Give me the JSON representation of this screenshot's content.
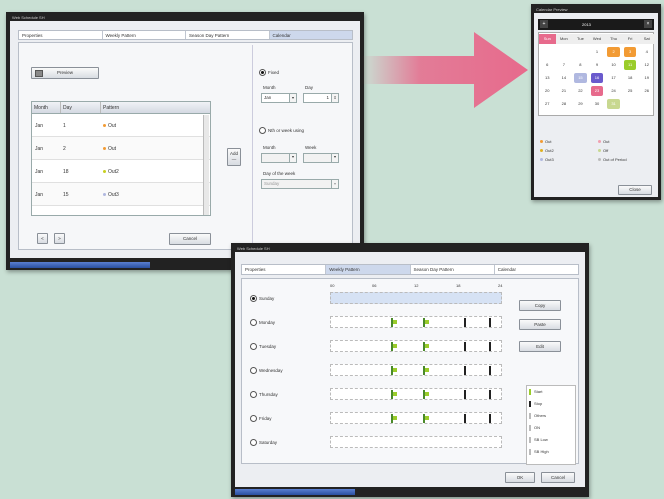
{
  "colors": {
    "accent": "#e76a8c",
    "header_blue": "#0d3a82",
    "green": "#9acc2a",
    "orange": "#f29b34",
    "selection": "#cdd8ec"
  },
  "w1": {
    "title": "Web Schedule SH",
    "tabs": [
      "Properties",
      "Weekly Pattern",
      "Season Day Pattern",
      "Calendar"
    ],
    "preview": "Preview",
    "cols": [
      "Month",
      "Day",
      "Pattern"
    ],
    "rows": [
      [
        "Jan",
        "1",
        "Out"
      ],
      [
        "Jan",
        "2",
        "Out"
      ],
      [
        "Jan",
        "18",
        "Out2"
      ],
      [
        "Jan",
        "15",
        "Out3"
      ]
    ],
    "add": "Add",
    "fixed": "Fixed",
    "month": "Month",
    "day": "Day",
    "month_val": "Jan",
    "day_val": "1",
    "nth": "Nth or week using",
    "week": "Week",
    "dow": "Day of the week",
    "dow_val": "Sunday",
    "cancel": "Cancel",
    "prev": "<",
    "next": ">"
  },
  "w2": {
    "title": "Calendar Preview",
    "month": "2013",
    "days": [
      "Sun",
      "Mon",
      "Tue",
      "Wed",
      "Thu",
      "Fri",
      "Sat"
    ],
    "dates": [
      [
        "",
        "",
        "",
        "1",
        "2",
        "3",
        "4"
      ],
      [
        "6",
        "7",
        "8",
        "9",
        "10",
        "11",
        "12"
      ],
      [
        "13",
        "14",
        "15",
        "16",
        "17",
        "18",
        "19"
      ],
      [
        "20",
        "21",
        "22",
        "23",
        "24",
        "25",
        "26"
      ],
      [
        "27",
        "28",
        "29",
        "30",
        "31",
        "",
        ""
      ]
    ],
    "legend": [
      [
        "Out",
        "#f29b34"
      ],
      [
        "Out",
        "#f0a0b0"
      ],
      [
        "Out2",
        "#e0b020"
      ],
      [
        "Off",
        "#c8d890"
      ],
      [
        "Out3",
        "#b0b8e0"
      ],
      [
        "Out of Period",
        "#bbbbbb"
      ]
    ],
    "close": "Close"
  },
  "w3": {
    "title": "Web Schedule SH",
    "tabs": [
      "Properties",
      "Weekly Pattern",
      "Season Day Pattern",
      "Calendar"
    ],
    "ticks": [
      "00",
      "03",
      "06",
      "09",
      "12",
      "15",
      "18",
      "21",
      "24"
    ],
    "days": [
      "Sunday",
      "Monday",
      "Tuesday",
      "Wednesday",
      "Thursday",
      "Friday",
      "Saturday"
    ],
    "selected": "Sunday",
    "copy": "Copy",
    "paste": "Paste",
    "edit": "Edit",
    "legend": [
      "Start",
      "Stop",
      "Others",
      "ON",
      "SB Low",
      "SB High"
    ],
    "ok": "OK",
    "cancel": "Cancel"
  }
}
